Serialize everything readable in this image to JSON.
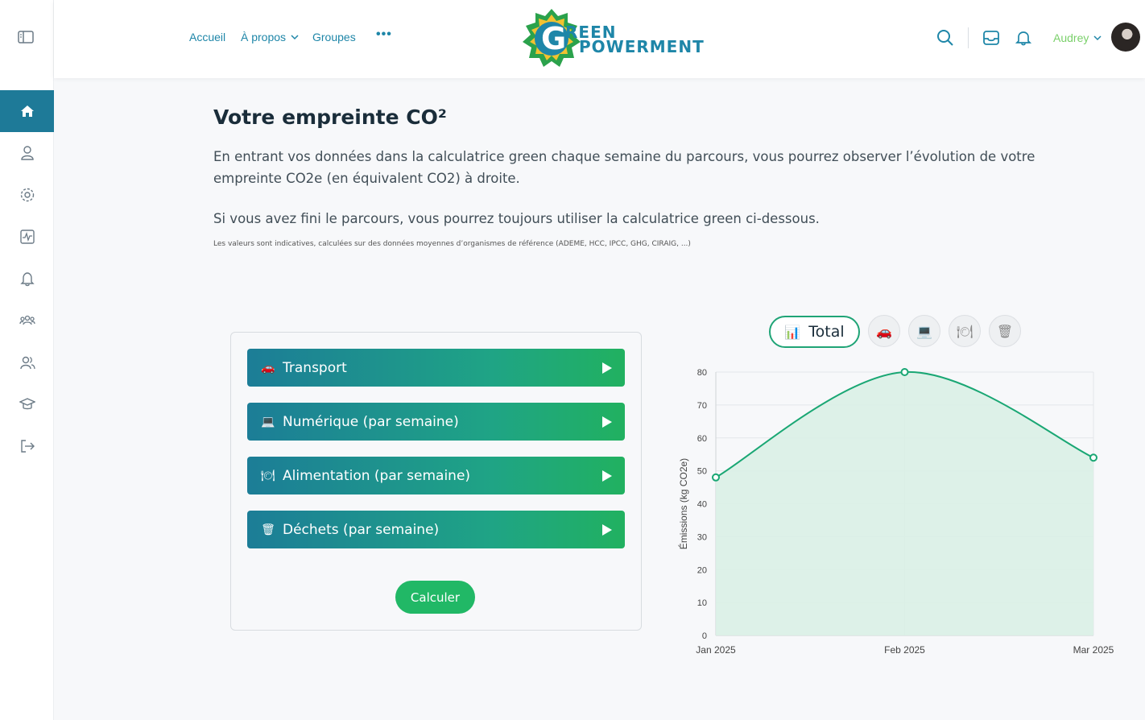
{
  "sidebar": {
    "toggle_icon": "sidebar-toggle-icon",
    "items": [
      {
        "name": "home",
        "icon": "home-icon",
        "active": true
      },
      {
        "name": "profile",
        "icon": "user-icon"
      },
      {
        "name": "settings",
        "icon": "gear-icon"
      },
      {
        "name": "activity",
        "icon": "activity-icon"
      },
      {
        "name": "notifications",
        "icon": "bell-icon"
      },
      {
        "name": "community",
        "icon": "group-icon"
      },
      {
        "name": "members",
        "icon": "users-icon"
      },
      {
        "name": "courses",
        "icon": "graduation-cap-icon"
      },
      {
        "name": "logout",
        "icon": "logout-icon"
      }
    ]
  },
  "header": {
    "nav": {
      "accueil": "Accueil",
      "apropos": "À propos",
      "groupes": "Groupes",
      "more": "•••"
    },
    "logo": {
      "line1": "REEN",
      "line2": "POWERMENT"
    },
    "user_name": "Audrey",
    "colors": {
      "accent": "#1e86a8",
      "user": "#7ad06a"
    }
  },
  "main": {
    "title": "Votre empreinte CO²",
    "intro": "En entrant vos données dans la calculatrice green chaque semaine du parcours, vous pourrez observer l’évolution de votre empreinte CO2e (en équivalent CO2) à droite.",
    "intro2": "Si vous avez fini le parcours, vous pourrez toujours utiliser la calculatrice green ci-dessous.",
    "note": "Les valeurs sont indicatives, calculées sur des données moyennes d’organismes de référence (ADEME, HCC, IPCC, GHG, CIRAIG, ...)"
  },
  "calculator": {
    "sections": [
      {
        "emoji": "🚗",
        "label": "Transport"
      },
      {
        "emoji": "💻",
        "label": "Numérique (par semaine)"
      },
      {
        "emoji": "🍽",
        "label": "Alimentation (par semaine)"
      },
      {
        "emoji": "🗑",
        "label": "Déchets (par semaine)"
      }
    ],
    "calculate_label": "Calculer"
  },
  "filters": {
    "total_label": "Total",
    "total_icon": "📊",
    "others": [
      {
        "name": "transport",
        "icon": "🚗"
      },
      {
        "name": "numerique",
        "icon": "💻"
      },
      {
        "name": "alimentation",
        "icon": "🍽"
      },
      {
        "name": "dechets",
        "icon": "🗑"
      }
    ]
  },
  "chart_data": {
    "type": "area",
    "x": [
      "Jan 2025",
      "Feb 2025",
      "Mar 2025"
    ],
    "series": [
      {
        "values": [
          48,
          80,
          54
        ]
      }
    ],
    "ylabel": "Émissions (kg CO2e)",
    "xlabel": "",
    "ylim": [
      0,
      80
    ],
    "yticks": [
      0,
      10,
      20,
      30,
      40,
      50,
      60,
      70,
      80
    ],
    "grid": true,
    "line_color": "#1aa774",
    "fill_color": "#d9f0e6"
  }
}
